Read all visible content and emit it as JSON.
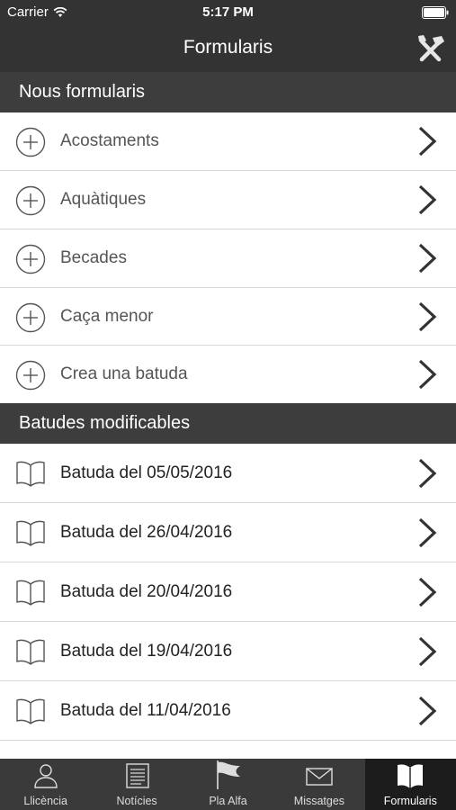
{
  "status": {
    "carrier": "Carrier",
    "time": "5:17 PM"
  },
  "nav": {
    "title": "Formularis"
  },
  "sections": {
    "new_forms": {
      "header": "Nous formularis",
      "items": [
        "Acostaments",
        "Aquàtiques",
        "Becades",
        "Caça menor",
        "Crea una batuda"
      ]
    },
    "editable": {
      "header": "Batudes modificables",
      "items": [
        "Batuda del 05/05/2016",
        "Batuda del 26/04/2016",
        "Batuda del 20/04/2016",
        "Batuda del 19/04/2016",
        "Batuda del 11/04/2016"
      ]
    }
  },
  "tabs": [
    {
      "label": "Llicència",
      "icon": "person-icon"
    },
    {
      "label": "Notícies",
      "icon": "newspaper-icon"
    },
    {
      "label": "Pla Alfa",
      "icon": "flag-icon"
    },
    {
      "label": "Missatges",
      "icon": "envelope-icon"
    },
    {
      "label": "Formularis",
      "icon": "book-icon",
      "active": true
    }
  ],
  "colors": {
    "bar": "#333333",
    "section": "#3d3d3d",
    "active_tab": "#1c1c1c"
  }
}
